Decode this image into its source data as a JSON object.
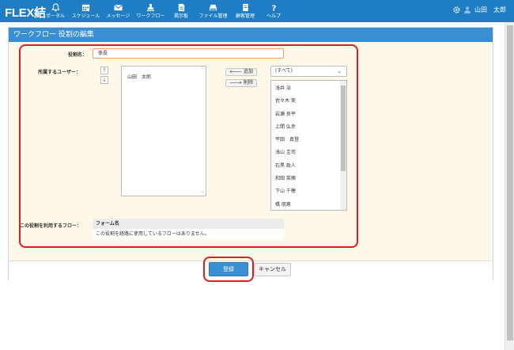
{
  "app": {
    "logo": "FLEX結"
  },
  "nav": [
    {
      "label": "ポータル",
      "icon": "bell-icon"
    },
    {
      "label": "スケジュール",
      "icon": "calendar-icon"
    },
    {
      "label": "メッセージ",
      "icon": "mail-icon"
    },
    {
      "label": "ワークフロー",
      "icon": "stamp-icon"
    },
    {
      "label": "掲示板",
      "icon": "board-icon"
    },
    {
      "label": "ファイル管理",
      "icon": "drive-icon"
    },
    {
      "label": "顧客管理",
      "icon": "customer-icon"
    },
    {
      "label": "ヘルプ",
      "icon": "help-icon"
    }
  ],
  "user": {
    "name": "山田　太郎"
  },
  "panel": {
    "title": "ワークフロー 役割の編集"
  },
  "form": {
    "role_label": "役割名：",
    "role_value": "係長",
    "users_label": "所属するユーザー：",
    "members": [
      "山田　太郎"
    ],
    "add_label": "追加",
    "remove_label": "削除",
    "filter_value": "(すべて)",
    "candidates": [
      "浅井 治",
      "佐々木 実",
      "岩瀬 良平",
      "上間 弘幸",
      "平田　真登",
      "浅山 圭司",
      "石黒 政人",
      "和田 菜摘",
      "下山 千穂",
      "橋 朋恵"
    ],
    "flows_label": "この役割を利用するフロー：",
    "flows_header": "フォーム名",
    "flows_empty": "この役割を経路に使用しているフローはありません。"
  },
  "footer": {
    "submit_label": "登録",
    "cancel_label": "キャンセル"
  },
  "colors": {
    "header": "#1f7ec3",
    "panel_head": "#3a8ed2",
    "form_bg": "#fdf8e7",
    "highlight": "#e01b24",
    "input_border": "#f0a060"
  }
}
